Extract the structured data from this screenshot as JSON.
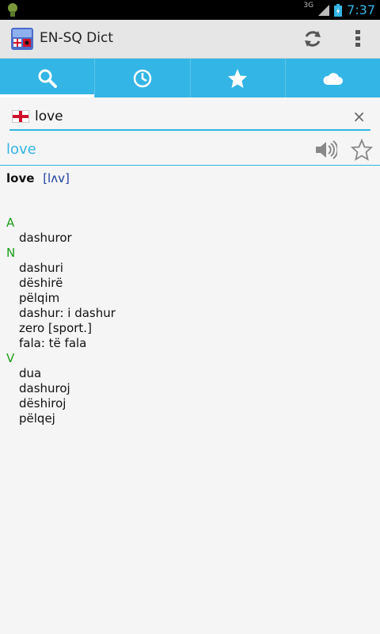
{
  "status_bar": {
    "network": "3G",
    "time": "7:37"
  },
  "action_bar": {
    "title": "EN-SQ Dict"
  },
  "tabs": [
    {
      "name": "search",
      "icon": "search-icon",
      "active": true
    },
    {
      "name": "history",
      "icon": "clock-icon",
      "active": false
    },
    {
      "name": "favorites",
      "icon": "star-icon",
      "active": false
    },
    {
      "name": "cloud",
      "icon": "cloud-icon",
      "active": false
    }
  ],
  "search": {
    "value": "love",
    "clear_label": "×"
  },
  "result": {
    "word": "love"
  },
  "definition": {
    "headword": "love",
    "pronunciation": "[lʌv]",
    "groups": [
      {
        "pos": "A",
        "translations": [
          "dashuror"
        ]
      },
      {
        "pos": "N",
        "translations": [
          "dashuri",
          "dëshirë",
          "pëlqim",
          "dashur: i dashur",
          "zero [sport.]",
          "fala: të fala"
        ]
      },
      {
        "pos": "V",
        "translations": [
          "dua",
          "dashuroj",
          "dëshiroj",
          "pëlqej"
        ]
      }
    ]
  },
  "colors": {
    "accent": "#33b5e5",
    "pos_green": "#1a9e1a",
    "pron_blue": "#1a3fa0"
  }
}
